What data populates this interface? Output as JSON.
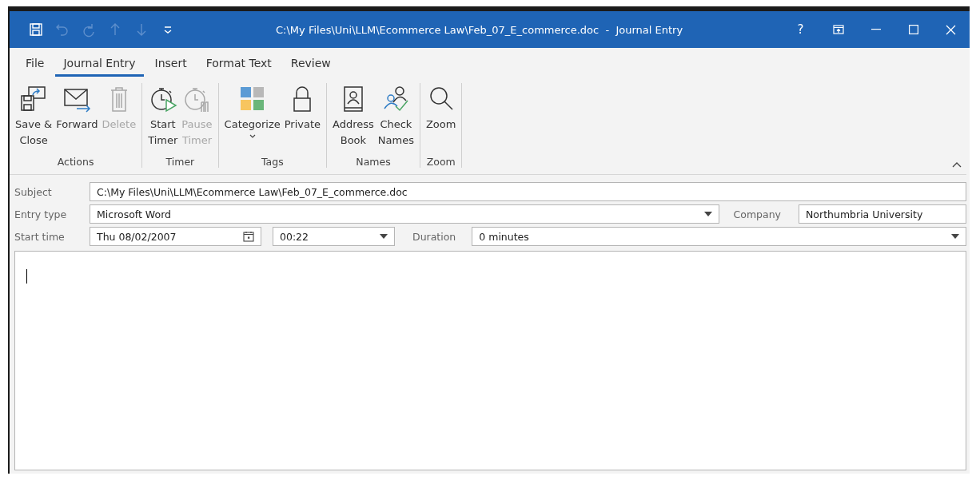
{
  "window": {
    "title": "C:\\My Files\\Uni\\LLM\\Ecommerce Law\\Feb_07_E_commerce.doc  -  Journal Entry",
    "help": "?"
  },
  "quick_access": [
    {
      "kind": "save",
      "disabled": false
    },
    {
      "kind": "undo",
      "disabled": true
    },
    {
      "kind": "redo",
      "disabled": true
    },
    {
      "kind": "up",
      "disabled": true
    },
    {
      "kind": "down",
      "disabled": true
    },
    {
      "kind": "customize",
      "disabled": false
    }
  ],
  "tabs": [
    {
      "label": "File",
      "selected": false
    },
    {
      "label": "Journal Entry",
      "selected": true
    },
    {
      "label": "Insert",
      "selected": false
    },
    {
      "label": "Format Text",
      "selected": false
    },
    {
      "label": "Review",
      "selected": false
    }
  ],
  "ribbon_groups": [
    {
      "name": "Actions",
      "buttons": [
        {
          "kind": "save-close",
          "label": "Save &\nClose",
          "disabled": false
        },
        {
          "kind": "forward",
          "label": "Forward",
          "disabled": false
        },
        {
          "kind": "delete",
          "label": "Delete",
          "disabled": true
        }
      ]
    },
    {
      "name": "Timer",
      "buttons": [
        {
          "kind": "start-timer",
          "label": "Start\nTimer",
          "disabled": false
        },
        {
          "kind": "pause-timer",
          "label": "Pause\nTimer",
          "disabled": true
        }
      ]
    },
    {
      "name": "Tags",
      "buttons": [
        {
          "kind": "categorize",
          "label": "Categorize",
          "disabled": false,
          "dropdown": true
        },
        {
          "kind": "private",
          "label": "Private",
          "disabled": false
        }
      ]
    },
    {
      "name": "Names",
      "buttons": [
        {
          "kind": "address-book",
          "label": "Address\nBook",
          "disabled": false
        },
        {
          "kind": "check-names",
          "label": "Check\nNames",
          "disabled": false
        }
      ]
    },
    {
      "name": "Zoom",
      "buttons": [
        {
          "kind": "zoom",
          "label": "Zoom",
          "disabled": false
        }
      ]
    }
  ],
  "form": {
    "subject": {
      "label": "Subject",
      "value": "C:\\My Files\\Uni\\LLM\\Ecommerce Law\\Feb_07_E_commerce.doc"
    },
    "entry_type": {
      "label": "Entry type",
      "value": "Microsoft Word"
    },
    "company": {
      "label": "Company",
      "value": "Northumbria University"
    },
    "start_time": {
      "label": "Start time",
      "date": "Thu 08/02/2007",
      "time": "00:22"
    },
    "duration": {
      "label": "Duration",
      "value": "0 minutes"
    }
  }
}
